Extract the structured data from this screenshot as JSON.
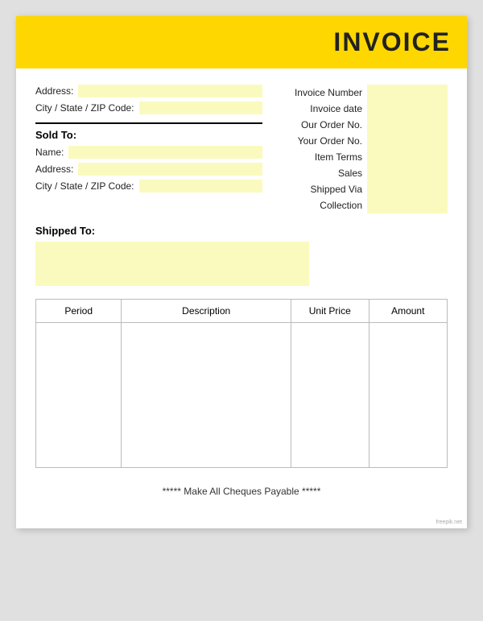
{
  "header": {
    "title": "INVOICE"
  },
  "left": {
    "address_label": "Address:",
    "city_label": "City / State / ZIP Code:",
    "sold_to_label": "Sold To:",
    "name_label": "Name:",
    "address2_label": "Address:",
    "city2_label": "City / State / ZIP Code:"
  },
  "right": {
    "fields": [
      {
        "label": "Invoice Number"
      },
      {
        "label": "Invoice date"
      },
      {
        "label": "Our Order No."
      },
      {
        "label": "Your Order No."
      },
      {
        "label": "Item Terms"
      },
      {
        "label": "Sales"
      },
      {
        "label": "Shipped Via"
      },
      {
        "label": "Collection"
      }
    ]
  },
  "shipped_to": {
    "label": "Shipped To:"
  },
  "table": {
    "headers": [
      "Period",
      "Description",
      "Unit Price",
      "Amount"
    ]
  },
  "footer": {
    "note": "***** Make All Cheques Payable *****"
  },
  "watermark": "freepik.net"
}
